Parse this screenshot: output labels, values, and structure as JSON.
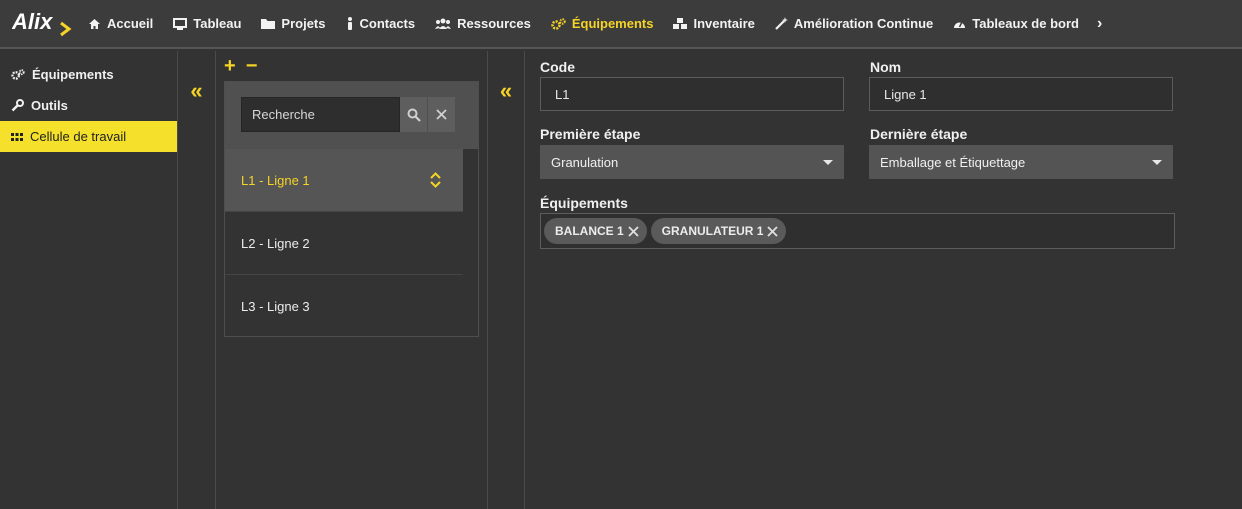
{
  "app": {
    "logo_text": "ALIX"
  },
  "nav": {
    "items": [
      {
        "label": "Accueil",
        "icon": "home-icon"
      },
      {
        "label": "Tableau",
        "icon": "monitor-icon"
      },
      {
        "label": "Projets",
        "icon": "folder-icon"
      },
      {
        "label": "Contacts",
        "icon": "person-icon"
      },
      {
        "label": "Ressources",
        "icon": "users-icon"
      },
      {
        "label": "Équipements",
        "icon": "cogs-icon",
        "active": true
      },
      {
        "label": "Inventaire",
        "icon": "cubes-icon"
      },
      {
        "label": "Amélioration Continue",
        "icon": "magic-wand-icon"
      },
      {
        "label": "Tableaux de bord",
        "icon": "dashboard-icon"
      }
    ],
    "more": "›"
  },
  "sidebar": {
    "items": [
      {
        "label": "Équipements",
        "icon": "cogs-icon"
      },
      {
        "label": "Outils",
        "icon": "wrench-icon"
      },
      {
        "label": "Cellule de travail",
        "icon": "grid-icon",
        "active": true
      }
    ]
  },
  "list": {
    "add": "+",
    "remove": "−",
    "search_placeholder": "Recherche",
    "items": [
      {
        "label": "L1 - Ligne 1",
        "selected": true
      },
      {
        "label": "L2 - Ligne 2"
      },
      {
        "label": "L3 - Ligne 3"
      }
    ]
  },
  "collapse": {
    "glyph": "«"
  },
  "form": {
    "code_label": "Code",
    "code_value": "L1",
    "nom_label": "Nom",
    "nom_value": "Ligne 1",
    "first_step_label": "Première étape",
    "first_step_value": "Granulation",
    "last_step_label": "Dernière étape",
    "last_step_value": "Emballage et Étiquettage",
    "equipements_label": "Équipements",
    "tags": [
      "BALANCE 1",
      "GRANULATEUR 1"
    ]
  },
  "colors": {
    "accent": "#f5d327",
    "background": "#333333",
    "topbar": "#3c3c3c"
  }
}
